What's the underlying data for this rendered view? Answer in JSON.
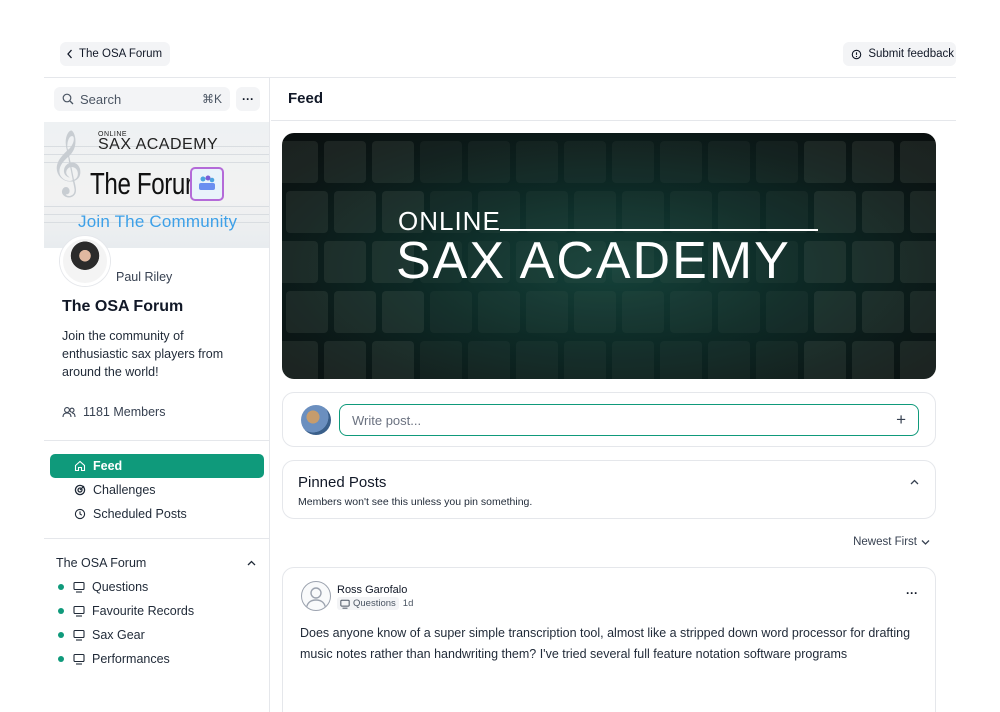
{
  "topbar": {
    "back_label": "The OSA Forum",
    "feedback_label": "Submit feedback"
  },
  "sidebar": {
    "search_placeholder": "Search",
    "search_shortcut": "⌘K",
    "more_label": "···",
    "banner": {
      "brand_online": "ONLINE",
      "brand_name": "SAX ACADEMY",
      "forum_title": "The Forum",
      "join_text": "Join The Community"
    },
    "author_name": "Paul Riley",
    "community_title": "The OSA Forum",
    "community_desc": "Join the community of enthusiastic sax players from around the world!",
    "members_text": "1181 Members",
    "nav": [
      {
        "label": "Feed",
        "icon": "home-icon",
        "active": true
      },
      {
        "label": "Challenges",
        "icon": "challenge-icon",
        "active": false
      },
      {
        "label": "Scheduled Posts",
        "icon": "clock-icon",
        "active": false
      }
    ],
    "group_title": "The OSA Forum",
    "spaces": [
      {
        "label": "Questions",
        "icon": "chat-icon"
      },
      {
        "label": "Favourite Records",
        "icon": "chat-icon"
      },
      {
        "label": "Sax Gear",
        "icon": "chat-icon"
      },
      {
        "label": "Performances",
        "icon": "chat-icon"
      }
    ]
  },
  "main": {
    "title": "Feed",
    "hero": {
      "online": "ONLINE",
      "brand": "SAX ACADEMY"
    },
    "composer_placeholder": "Write post...",
    "composer_plus": "+",
    "pinned": {
      "title": "Pinned Posts",
      "subtitle": "Members won't see this unless you pin something."
    },
    "sort_label": "Newest First",
    "post": {
      "author": "Ross Garofalo",
      "space": "Questions",
      "time": "1d",
      "more": "···",
      "text": "Does anyone know of a super simple transcription tool, almost like a stripped down word processor for drafting music notes rather than handwriting them? I've tried several full feature notation software programs"
    }
  },
  "colors": {
    "accent": "#0f9a7b",
    "join_blue": "#3da0e8",
    "forum_logo_border": "#b46ad8"
  }
}
